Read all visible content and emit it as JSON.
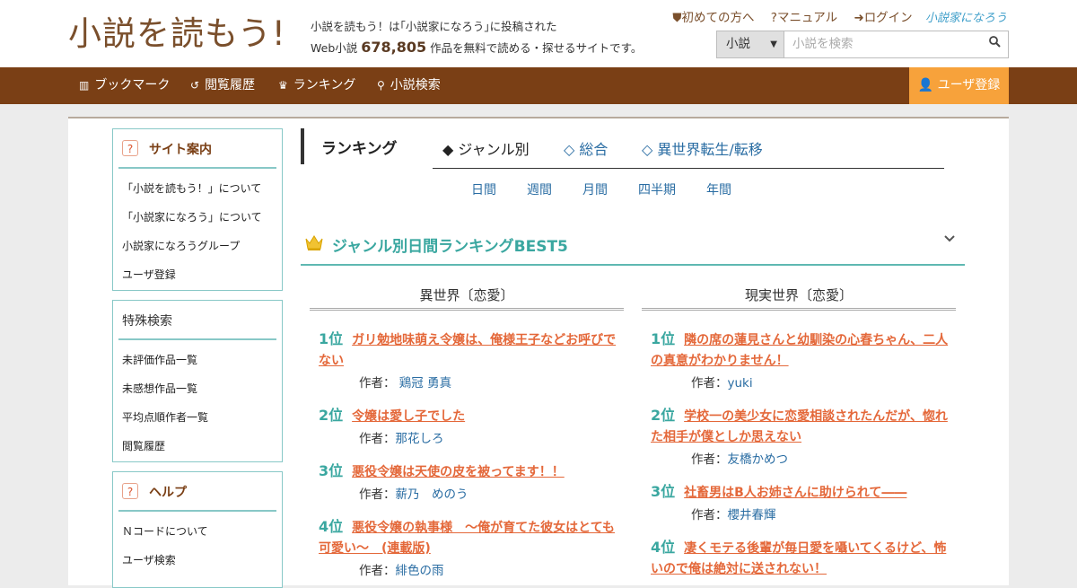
{
  "header": {
    "logo": "小説を読もう!",
    "tagline_line1": "小説を読もう！は｢小説家になろう｣に投稿された",
    "tagline_prefix": "Web小説",
    "work_count": "678,805",
    "tagline_suffix": "作品を無料で読める・探せるサイトです。",
    "links": [
      "初めての方へ",
      "マニュアル",
      "ログイン"
    ],
    "partner_logo": "小説家になろう",
    "search": {
      "category": "小説",
      "placeholder": "小説を検索"
    }
  },
  "nav": {
    "items": [
      "ブックマーク",
      "閲覧履歴",
      "ランキング",
      "小説検索"
    ],
    "register": "ユーザ登録"
  },
  "sidebar": {
    "site_guide": {
      "title": "サイト案内",
      "items": [
        "「小説を読もう！」について",
        "「小説家になろう」について",
        "小説家になろうグループ",
        "ユーザ登録"
      ]
    },
    "special_search": {
      "title": "特殊検索",
      "items": [
        "未評価作品一覧",
        "未感想作品一覧",
        "平均点順作者一覧",
        "閲覧履歴"
      ]
    },
    "help": {
      "title": "ヘルプ",
      "items": [
        "Ｎコードについて",
        "ユーザ検索"
      ]
    }
  },
  "ranking": {
    "title": "ランキング",
    "tabs": [
      "◆ ジャンル別",
      "◇ 総合",
      "◇ 異世界転生/転移"
    ],
    "periods": [
      "日間",
      "週間",
      "月間",
      "四半期",
      "年間"
    ],
    "best_title": "ジャンル別日間ランキングBEST5",
    "author_label": "作者：",
    "columns": [
      {
        "title": "異世界〔恋愛〕",
        "entries": [
          {
            "rank": "1位",
            "title": "ガリ勉地味萌え令嬢は、俺様王子などお呼びでない",
            "author": "鶏冠 勇真"
          },
          {
            "rank": "2位",
            "title": "令嬢は愛し子でした",
            "author": "那花しろ"
          },
          {
            "rank": "3位",
            "title": "悪役令嬢は天使の皮を被ってます！！",
            "author": "薪乃　めのう"
          },
          {
            "rank": "4位",
            "title": "悪役令嬢の執事様　～俺が育てた彼女はとても可愛い～　(連載版)",
            "author": "緋色の雨"
          }
        ]
      },
      {
        "title": "現実世界〔恋愛〕",
        "entries": [
          {
            "rank": "1位",
            "title": "隣の席の蓮見さんと幼馴染の心春ちゃん、二人の真意がわかりません！",
            "author": "yuki"
          },
          {
            "rank": "2位",
            "title": "学校一の美少女に恋愛相談されたんだが、惚れた相手が僕としか思えない",
            "author": "友橋かめつ"
          },
          {
            "rank": "3位",
            "title": "社畜男はB人お姉さんに助けられて――",
            "author": "櫻井春輝"
          },
          {
            "rank": "4位",
            "title": "凄くモテる後輩が毎日愛を囁いてくるけど、怖いので俺は絶対に送されない！",
            "author": ""
          }
        ]
      }
    ]
  }
}
